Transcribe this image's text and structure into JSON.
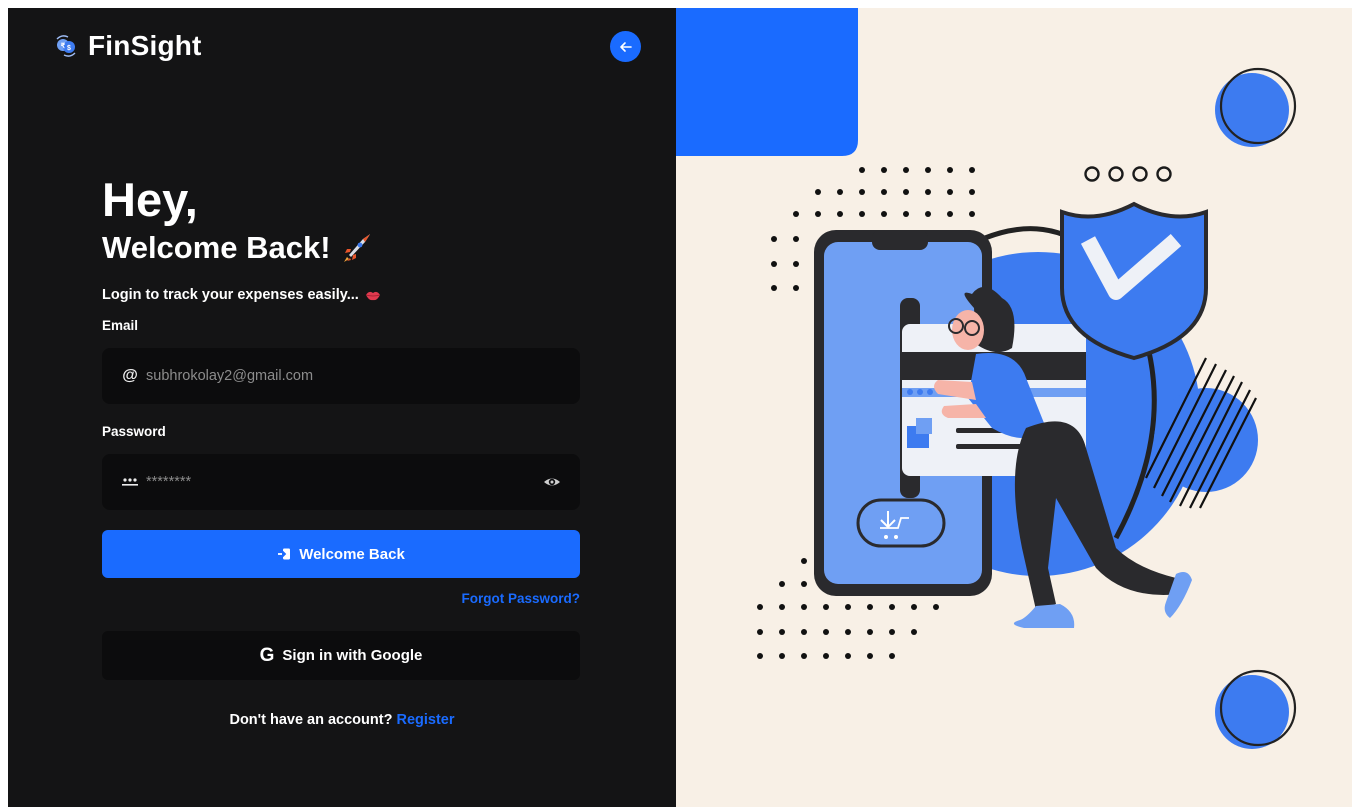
{
  "brand": {
    "name": "FinSight",
    "logo_icon": "currency-exchange-icon"
  },
  "header": {
    "back_icon": "arrow-left-icon"
  },
  "hero": {
    "greeting": "Hey,",
    "title": "Welcome Back!",
    "title_icon": "rocket-icon",
    "subtitle": "Login to track your expenses easily...",
    "subtitle_icon": "lips-icon"
  },
  "form": {
    "email": {
      "label": "Email",
      "value": "subhrokolay2@gmail.com",
      "icon": "at-icon"
    },
    "password": {
      "label": "Password",
      "value": "********",
      "icon": "password-dots-icon",
      "toggle_icon": "eye-icon"
    },
    "submit_label": "Welcome Back",
    "submit_icon": "login-icon",
    "forgot_label": "Forgot Password?",
    "google_label": "Sign in with Google",
    "google_icon": "google-icon",
    "register_prompt": "Don't have an account?",
    "register_link": "Register"
  },
  "colors": {
    "accent": "#1a6bff",
    "panel_dark": "#141415",
    "input_bg": "#0c0c0d",
    "illustration_bg": "#f8f0e6",
    "illustration_blue": "#3d7bf0",
    "illustration_light_blue": "#6f9ff3"
  },
  "illustration": {
    "name": "woman-entering-phone-security-illustration"
  }
}
